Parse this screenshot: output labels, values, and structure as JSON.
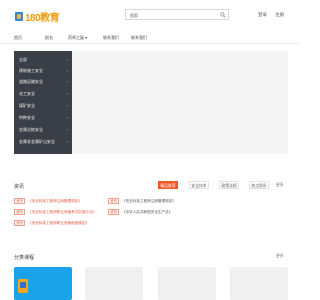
{
  "brand": {
    "name": "180教育"
  },
  "search": {
    "placeholder": "搜索"
  },
  "auth": {
    "login": "登录",
    "register": "注册"
  },
  "nav": {
    "items": [
      "首页",
      "报名",
      "药师之窗 ▾",
      "联系我们",
      "联系我们"
    ]
  },
  "categories": {
    "items": [
      {
        "label": "全部"
      },
      {
        "label": "建筑施工安全"
      },
      {
        "label": "道路运输安全"
      },
      {
        "label": "化工安全"
      },
      {
        "label": "煤矿安全"
      },
      {
        "label": "特种安全"
      },
      {
        "label": "金属冶炼安全"
      },
      {
        "label": "金属非金属矿山安全"
      }
    ],
    "arrow_glyph": "›"
  },
  "news": {
    "title": "资讯",
    "tabs": [
      "精品推荐",
      "安全技术",
      "政策法规",
      "热点资讯"
    ],
    "more": "更多",
    "items": [
      {
        "tag": "资讯",
        "text": "《安全标准工程师注册管理规定》",
        "color": "red"
      },
      {
        "tag": "资讯",
        "text": "《安全标准工程师注册管理规定》",
        "color": "gray"
      },
      {
        "tag": "资讯",
        "text": "《安全标准工程师职业资格考试实施办法》",
        "color": "red"
      },
      {
        "tag": "资讯",
        "text": "《中华人民共和国安全生产法》",
        "color": "gray"
      },
      {
        "tag": "资讯",
        "text": "《安全标准工程师职业资格制度规定》",
        "color": "red"
      }
    ]
  },
  "courses": {
    "title": "分类课程",
    "more": "更多"
  },
  "colors": {
    "accent": "#f15a24",
    "menu_bg": "#3a3f47",
    "brand_orange": "#f39c12",
    "course_blue": "#1aa3e8"
  }
}
